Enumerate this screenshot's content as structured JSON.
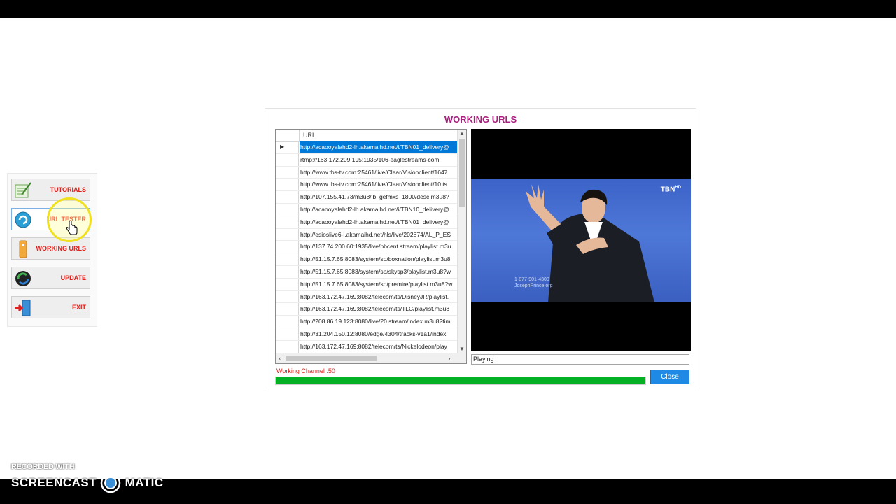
{
  "side_menu": {
    "items": [
      {
        "label": "TUTORIALS",
        "icon": "tutorials-icon"
      },
      {
        "label": "URL TESTER",
        "icon": "url-tester-icon"
      },
      {
        "label": "WORKING URLS",
        "icon": "working-urls-icon"
      },
      {
        "label": "UPDATE",
        "icon": "update-icon"
      },
      {
        "label": "EXIT",
        "icon": "exit-icon"
      }
    ]
  },
  "dialog": {
    "title": "WORKING URLS",
    "grid": {
      "column_header": "URL",
      "rows": [
        "http://acaooyalahd2-lh.akamaihd.net/i/TBN01_delivery@",
        "rtmp://163.172.209.195:1935/106-eaglestreams-com",
        "http://www.tbs-tv.com:25461/live/Clear/Visionclient/1647",
        "http://www.tbs-tv.com:25461/live/Clear/Visionclient/10.ts",
        "http://107.155.41.73/m3u8/lb_gefmxs_1800/desc.m3u8?",
        "http://acaooyalahd2-lh.akamaihd.net/i/TBN10_delivery@",
        "http://acaooyalahd2-lh.akamaihd.net/i/TBN01_delivery@",
        "http://esioslive6-i.akamaihd.net/hls/live/202874/AL_P_ES",
        "http://137.74.200.60:1935/live/bbcent.stream/playlist.m3u",
        "http://51.15.7.65:8083/system/sp/boxnation/playlist.m3u8",
        "http://51.15.7.65:8083/system/sp/skysp3/playlist.m3u8?w",
        "http://51.15.7.65:8083/system/sp/premire/playlist.m3u8?w",
        "http://163.172.47.169:8082/telecom/ts/DisneyJR/playlist.",
        "http://163.172.47.169:8082/telecom/ts/TLC/playlist.m3u8",
        "http://208.86.19.123:8080/live/20.stream/index.m3u8?tim",
        "http://31.204.150.12:8080/edge/4304/tracks-v1a1/index",
        "http://163.172.47.169:8082/telecom/ts/Nickelodeon/play"
      ],
      "selected_index": 0
    },
    "video": {
      "logo": "TBN",
      "logo_sup": "HD",
      "phone": "1-877-901-4300",
      "site": "JosephPrince.org"
    },
    "player_status": "Playing",
    "working_channel": "Working Channel :50",
    "progress": 1.0,
    "close_label": "Close"
  },
  "watermark": {
    "line1": "RECORDED WITH",
    "line2a": "SCREENCAST",
    "line2b": "MATIC"
  },
  "colors": {
    "title": "#a8207e",
    "menu_label": "#e0201b",
    "selection": "#0078d7",
    "progress": "#06b025",
    "close_button": "#1e8ae6"
  }
}
